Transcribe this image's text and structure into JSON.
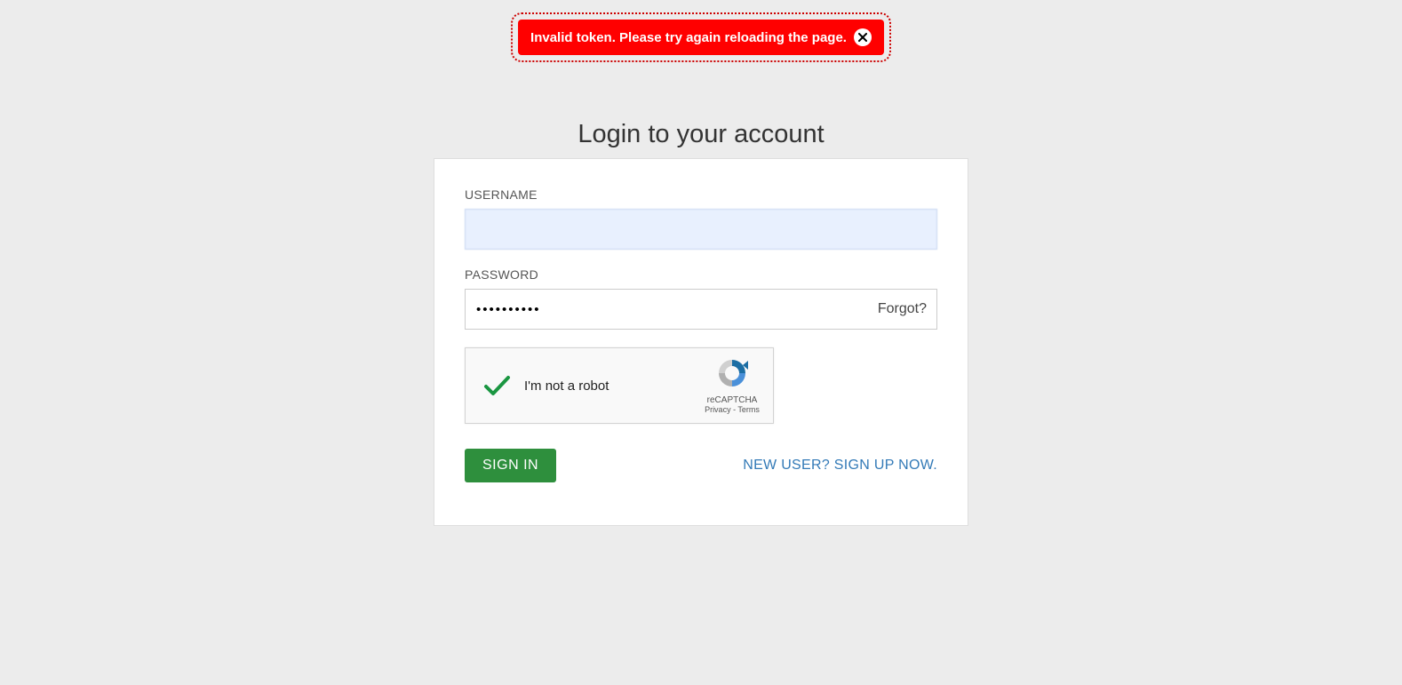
{
  "toast": {
    "message": "Invalid token. Please try again reloading the page."
  },
  "heading": "Login to your account",
  "form": {
    "username_label": "USERNAME",
    "username_value": "",
    "password_label": "PASSWORD",
    "password_value": "••••••••••",
    "forgot": "Forgot?"
  },
  "captcha": {
    "label": "I'm not a robot",
    "brand": "reCAPTCHA",
    "privacy": "Privacy",
    "terms": "Terms"
  },
  "actions": {
    "sign_in": "SIGN IN",
    "sign_up": "NEW USER? SIGN UP NOW."
  }
}
